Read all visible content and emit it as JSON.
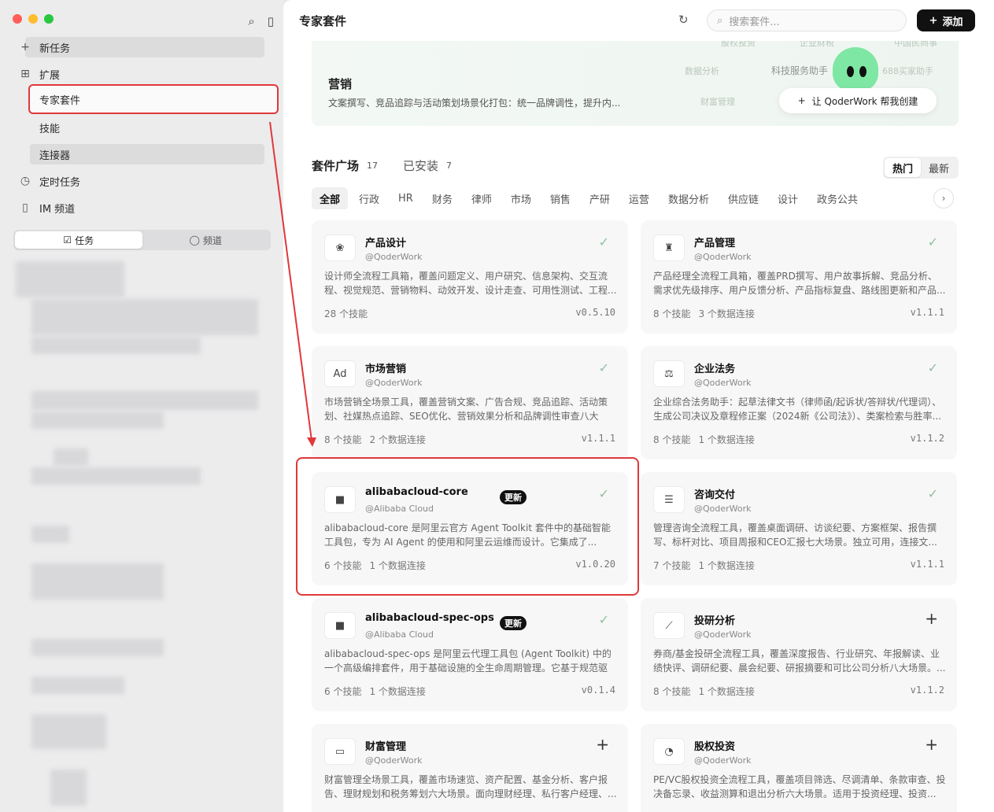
{
  "sidebar": {
    "new_task": "新任务",
    "extensions": "扩展",
    "expert_suites": "专家套件",
    "skills": "技能",
    "connectors": "连接器",
    "scheduled": "定时任务",
    "im_channel": "IM 频道",
    "seg_tasks": "任务",
    "seg_channels": "频道"
  },
  "header": {
    "title": "专家套件",
    "search_placeholder": "搜索套件...",
    "add_label": "添加"
  },
  "banner": {
    "title": "营销",
    "desc": "文案撰写、竞品追踪与活动策划场景化打包：统一品牌调性，提升内...",
    "ghost": [
      "股权投资",
      "企业财税",
      "中国民商事",
      "数据分析",
      "科技服务助手",
      "688买家助手",
      "财富管理"
    ],
    "create_label": "让 QoderWork 帮我创建"
  },
  "market": {
    "title": "套件广场",
    "count": "17",
    "installed": "已安装",
    "installed_count": "7",
    "sort_hot": "热门",
    "sort_new": "最新"
  },
  "categories": [
    "全部",
    "行政",
    "HR",
    "财务",
    "律师",
    "市场",
    "销售",
    "产研",
    "运营",
    "数据分析",
    "供应链",
    "设计",
    "政务公共"
  ],
  "cards": [
    {
      "name": "产品设计",
      "pub": "@QoderWork",
      "desc": "设计师全流程工具箱，覆盖问题定义、用户研究、信息架构、交互流程、视觉规范、营销物料、动效开发、设计走查、可用性测试、工程...",
      "f1": "28 个技能",
      "f2": "",
      "ver": "v0.5.10",
      "badge": "",
      "act": "✓",
      "icon": "❀"
    },
    {
      "name": "产品管理",
      "pub": "@QoderWork",
      "desc": "产品经理全流程工具箱，覆盖PRD撰写、用户故事拆解、竞品分析、需求优先级排序、用户反馈分析、产品指标复盘、路线图更新和产品...",
      "f1": "8 个技能",
      "f2": "3 个数据连接",
      "ver": "v1.1.1",
      "badge": "",
      "act": "✓",
      "icon": "♜"
    },
    {
      "name": "市场营销",
      "pub": "@QoderWork",
      "desc": "市场营销全场景工具，覆盖营销文案、广告合规、竞品追踪、活动策划、社媒热点追踪、SEO优化、营销效果分析和品牌调性审查八大场...",
      "f1": "8 个技能",
      "f2": "2 个数据连接",
      "ver": "v1.1.1",
      "badge": "",
      "act": "✓",
      "icon": "Ad"
    },
    {
      "name": "企业法务",
      "pub": "@QoderWork",
      "desc": "企业综合法务助手：起草法律文书（律师函/起诉状/答辩状/代理词）、生成公司决议及章程修正案（2024新《公司法》）、类案检索与胜率...",
      "f1": "8 个技能",
      "f2": "1 个数据连接",
      "ver": "v1.1.2",
      "badge": "",
      "act": "✓",
      "icon": "⚖"
    },
    {
      "name": "alibabacloud-core",
      "pub": "@Alibaba Cloud",
      "desc": "alibabacloud-core 是阿里云官方 Agent Toolkit 套件中的基础智能工具包，专为 AI Agent 的使用和阿里云运维而设计。它集成了...",
      "f1": "6 个技能",
      "f2": "1 个数据连接",
      "ver": "v1.0.20",
      "badge": "更新",
      "act": "✓",
      "icon": "■"
    },
    {
      "name": "咨询交付",
      "pub": "@QoderWork",
      "desc": "管理咨询全流程工具，覆盖桌面调研、访谈纪要、方案框架、报告撰写、标杆对比、项目周报和CEO汇报七大场景。独立可用，连接文...",
      "f1": "7 个技能",
      "f2": "1 个数据连接",
      "ver": "v1.1.1",
      "badge": "",
      "act": "✓",
      "icon": "☰"
    },
    {
      "name": "alibabacloud-spec-ops",
      "pub": "@Alibaba Cloud",
      "desc": "alibabacloud-spec-ops 是阿里云代理工具包 (Agent Toolkit) 中的一个高级编排套件，用于基础设施的全生命周期管理。它基于规范驱动...",
      "f1": "6 个技能",
      "f2": "1 个数据连接",
      "ver": "v0.1.4",
      "badge": "更新",
      "act": "✓",
      "icon": "■"
    },
    {
      "name": "投研分析",
      "pub": "@QoderWork",
      "desc": "券商/基金投研全流程工具，覆盖深度报告、行业研究、年报解读、业绩快评、调研纪要、晨会纪要、研报摘要和可比公司分析八大场景。...",
      "f1": "8 个技能",
      "f2": "1 个数据连接",
      "ver": "v1.1.2",
      "badge": "",
      "act": "+",
      "icon": "⟋"
    },
    {
      "name": "财富管理",
      "pub": "@QoderWork",
      "desc": "财富管理全场景工具，覆盖市场速览、资产配置、基金分析、客户报告、理财规划和税务筹划六大场景。面向理财经理、私行客户经理、...",
      "f1": "",
      "f2": "",
      "ver": "",
      "badge": "",
      "act": "+",
      "icon": "▭"
    },
    {
      "name": "股权投资",
      "pub": "@QoderWork",
      "desc": "PE/VC股权投资全流程工具，覆盖项目筛选、尽调清单、条款审查、投决备忘录、收益测算和退出分析六大场景。适用于投资经理、投资...",
      "f1": "",
      "f2": "",
      "ver": "",
      "badge": "",
      "act": "+",
      "icon": "◔"
    }
  ]
}
